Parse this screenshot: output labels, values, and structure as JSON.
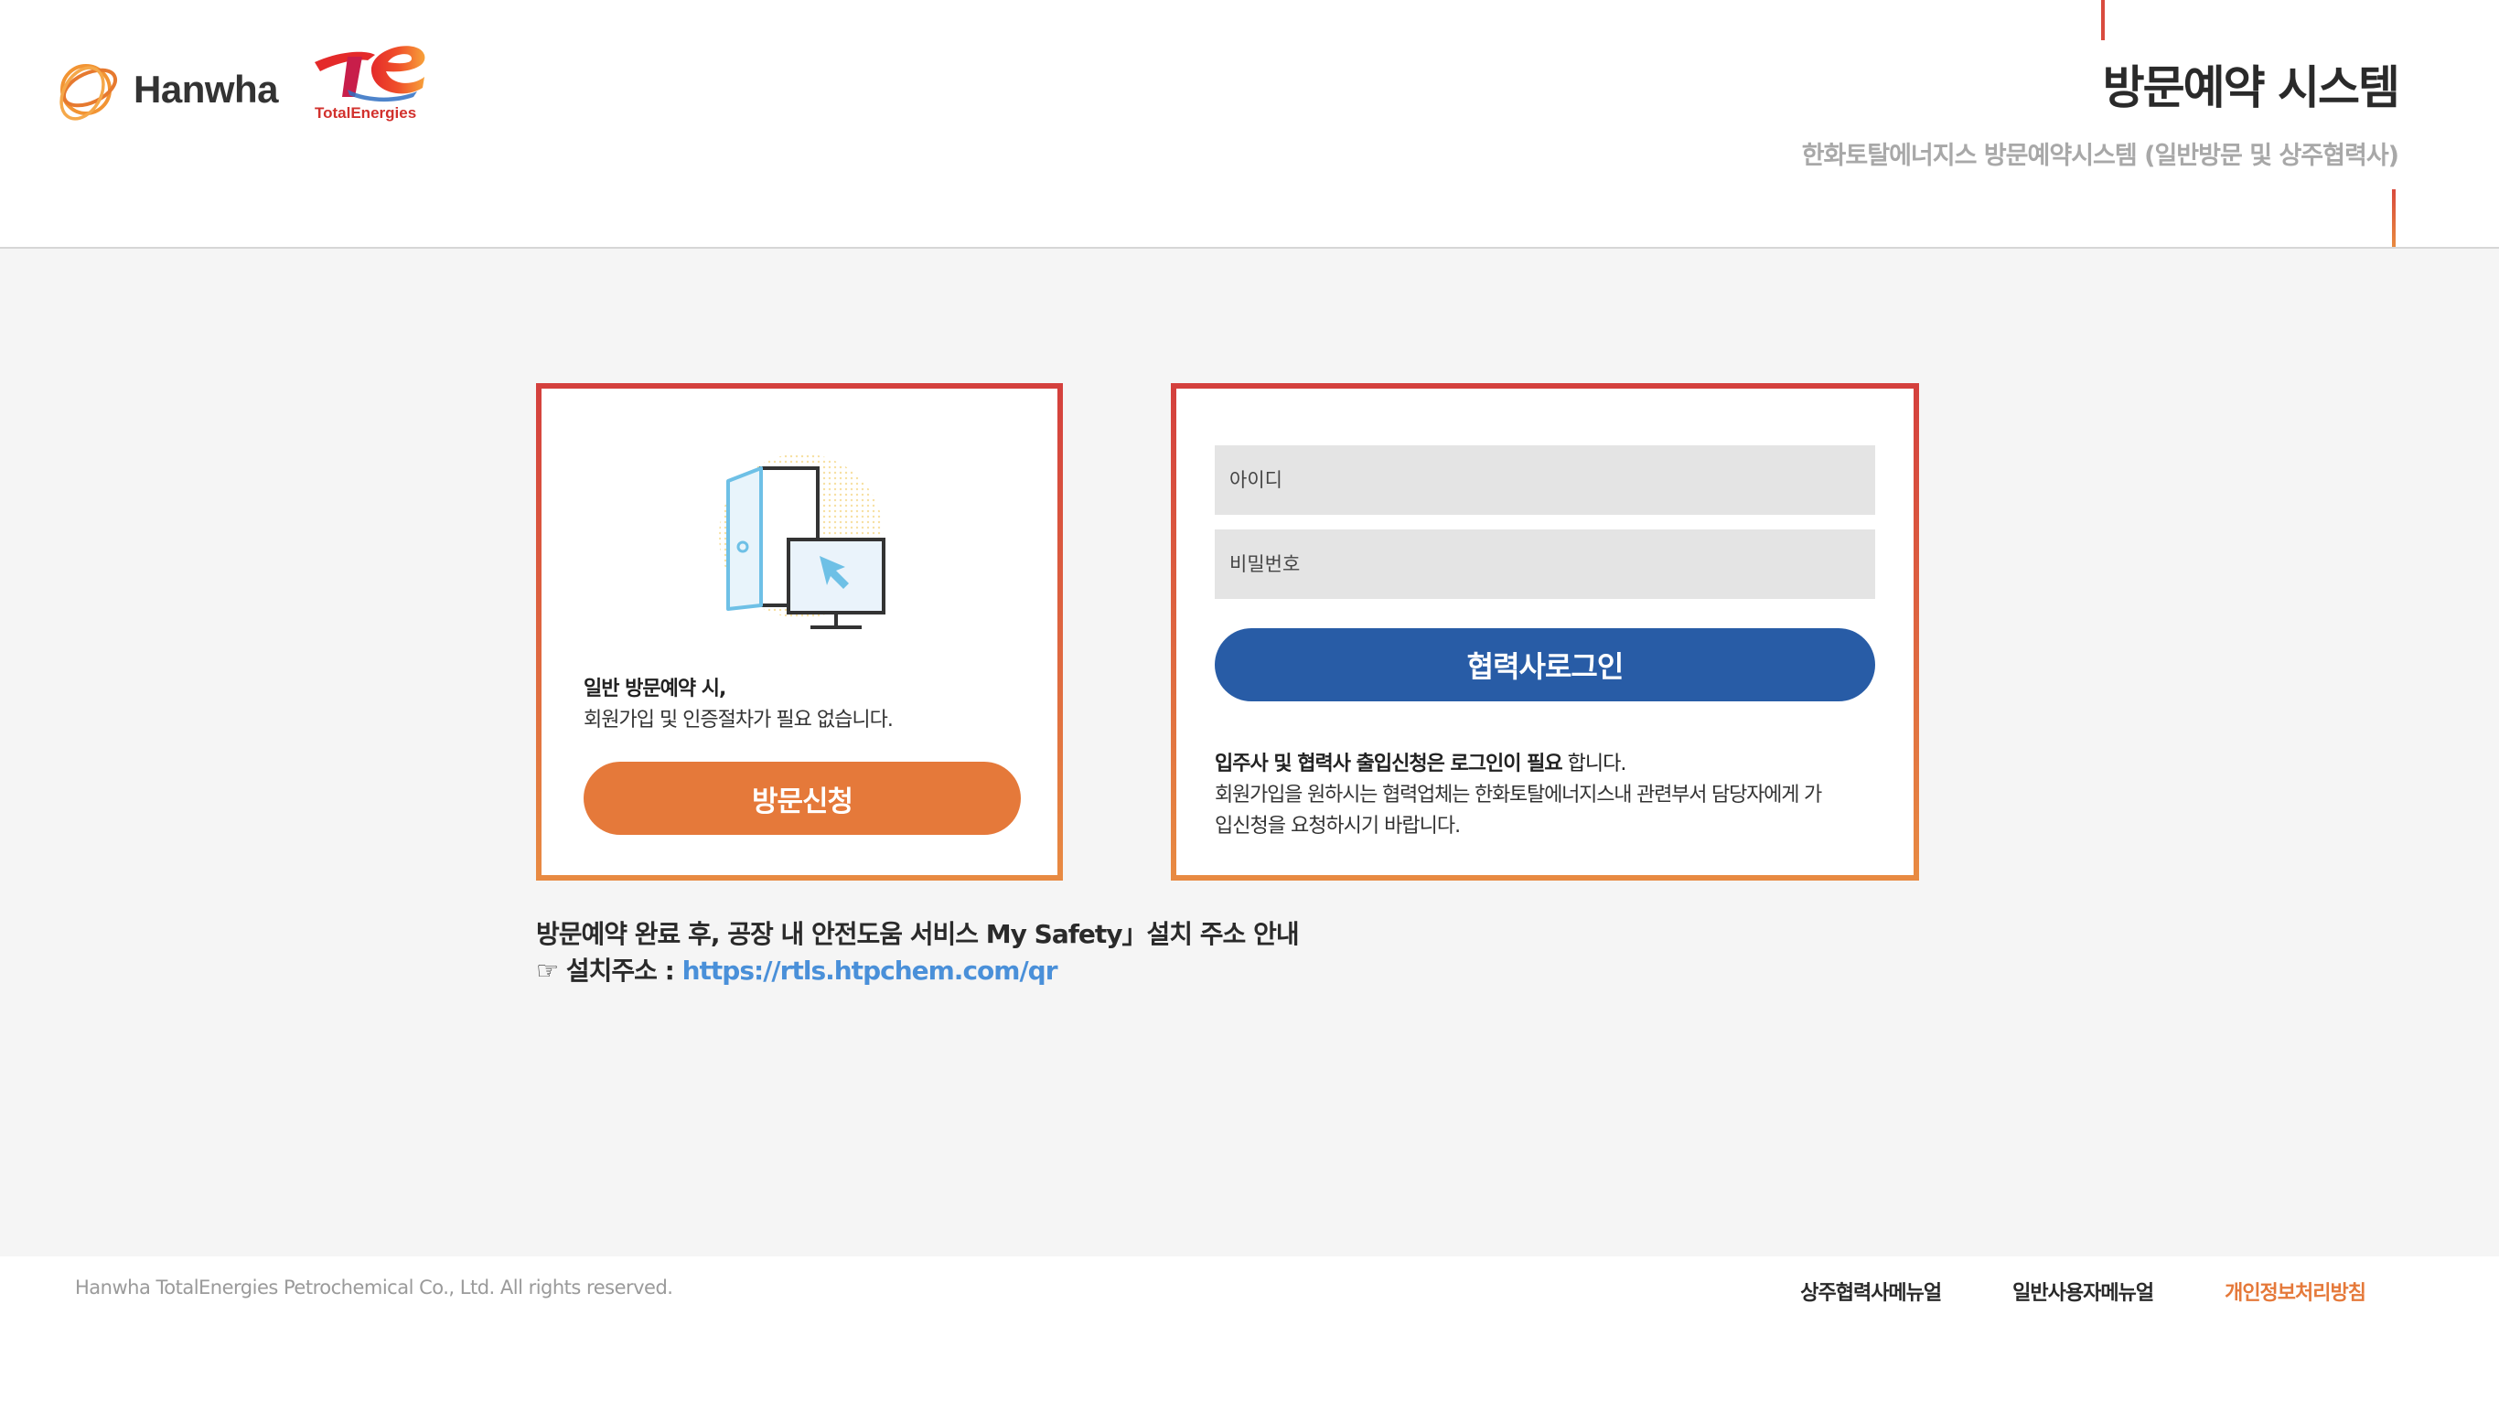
{
  "header": {
    "hanwha_logo_text": "Hanwha",
    "te_logo_text": "TotalEnergies",
    "title": "방문예약 시스템",
    "subtitle": "한화토탈에너지스 방문예약시스템 (일반방문 및 상주협력사)"
  },
  "visit_card": {
    "text_line1": "일반 방문예약 시,",
    "text_line2": "회원가입 및 인증절차가 필요 없습니다.",
    "button_label": "방문신청",
    "illustration": "door-monitor-illustration"
  },
  "login_card": {
    "id_placeholder": "아이디",
    "password_placeholder": "비밀번호",
    "button_label": "협력사로그인",
    "note_bold": "입주사 및 협력사 출입신청은 로그인이 필요",
    "note_rest": " 합니다.",
    "note_line2": "회원가입을 원하시는 협력업체는 한화토탈에너지스내 관련부서 담당자에게 가",
    "note_line3": "입신청을 요청하시기 바랍니다."
  },
  "notice": {
    "line1": "방문예약 완료 후, 공장 내 안전도움 서비스 My Safety」설치 주소 안내",
    "line2_prefix": "☞ 설치주소 : ",
    "link_text": "https://rtls.htpchem.com/qr"
  },
  "footer": {
    "copyright": "Hanwha TotalEnergies Petrochemical Co., Ltd. All rights reserved.",
    "links": [
      {
        "label": "상주협력사메뉴얼"
      },
      {
        "label": "일반사용자메뉴얼"
      },
      {
        "label": "개인정보처리방침"
      }
    ]
  },
  "colors": {
    "accent_orange": "#e5793a",
    "login_blue": "#285ca6",
    "card_border_red": "#d4403d",
    "link_blue": "#4a90d9"
  }
}
